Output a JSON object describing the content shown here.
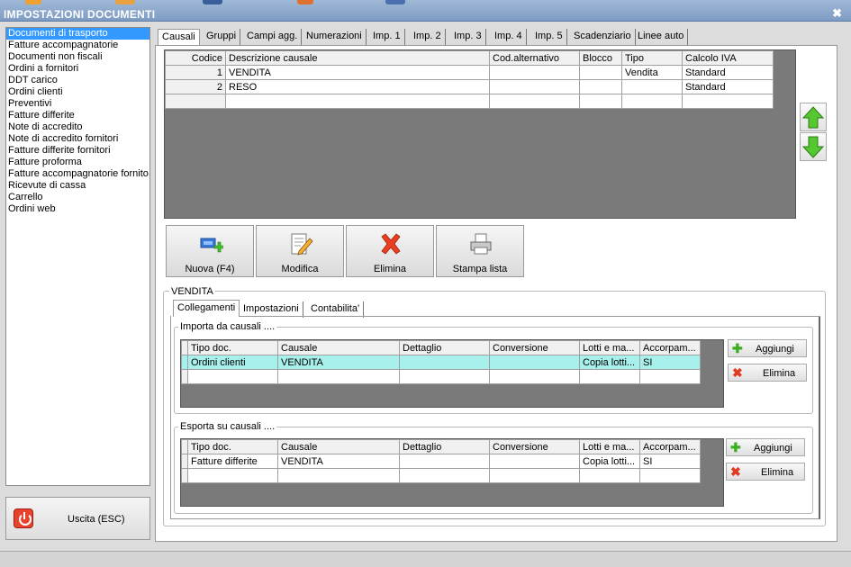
{
  "window": {
    "title": "IMPOSTAZIONI DOCUMENTI"
  },
  "sidebar": {
    "items": [
      "Documenti di trasporto",
      "Fatture accompagnatorie",
      "Documenti non fiscali",
      "Ordini a fornitori",
      "DDT carico",
      "Ordini clienti",
      "Preventivi",
      "Fatture differite",
      "Note di accredito",
      "Note di accredito fornitori",
      "Fatture differite fornitori",
      "Fatture proforma",
      "Fatture accompagnatorie fornito",
      "Ricevute di cassa",
      "Carrello",
      "Ordini web"
    ],
    "selected": "Documenti di trasporto",
    "exit_label": "Uscita (ESC)"
  },
  "tabs": [
    "Causali",
    "Gruppi",
    "Campi agg.",
    "Numerazioni",
    "Imp. 1",
    "Imp. 2",
    "Imp. 3",
    "Imp. 4",
    "Imp. 5",
    "Scadenziario",
    "Linee auto"
  ],
  "causali_grid": {
    "columns": [
      "Codice",
      "Descrizione causale",
      "Cod.alternativo",
      "Blocco",
      "Tipo",
      "Calcolo IVA"
    ],
    "rows": [
      {
        "codice": "1",
        "descrizione": "VENDITA",
        "cod_alt": "",
        "blocco": "",
        "tipo": "Vendita",
        "calcolo_iva": "Standard"
      },
      {
        "codice": "2",
        "descrizione": "RESO",
        "cod_alt": "",
        "blocco": "",
        "tipo": "",
        "calcolo_iva": "Standard"
      }
    ]
  },
  "actions": {
    "nuova": "Nuova (F4)",
    "modifica": "Modifica",
    "elimina": "Elimina",
    "stampa": "Stampa lista"
  },
  "detail": {
    "group_title": "VENDITA",
    "subtabs": [
      "Collegamenti",
      "Impostazioni",
      "Contabilita'"
    ],
    "importa": {
      "title": "Importa da causali ....",
      "columns": [
        "Tipo doc.",
        "Causale",
        "Dettaglio",
        "Conversione",
        "Lotti e ma...",
        "Accorpam..."
      ],
      "rows": [
        {
          "tipo_doc": "Ordini clienti",
          "causale": "VENDITA",
          "dettaglio": "",
          "conversione": "",
          "lotti": "Copia lotti...",
          "accorpam": "SI"
        }
      ],
      "add_label": "Aggiungi",
      "del_label": "Elimina"
    },
    "esporta": {
      "title": "Esporta su causali ....",
      "columns": [
        "Tipo doc.",
        "Causale",
        "Dettaglio",
        "Conversione",
        "Lotti e ma...",
        "Accorpam..."
      ],
      "rows": [
        {
          "tipo_doc": "Fatture differite",
          "causale": "VENDITA",
          "dettaglio": "",
          "conversione": "",
          "lotti": "Copia lotti...",
          "accorpam": "SI"
        }
      ],
      "add_label": "Aggiungi",
      "del_label": "Elimina"
    }
  }
}
